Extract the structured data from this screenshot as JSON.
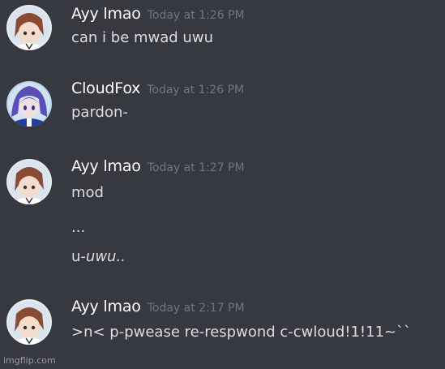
{
  "messages": [
    {
      "username": "Ayy lmao",
      "timestamp": "Today at 1:26 PM",
      "avatar_icon": "anime-avatar-brown-hair",
      "lines": [
        "can i be mwad uwu"
      ]
    },
    {
      "username": "CloudFox",
      "timestamp": "Today at 1:26 PM",
      "avatar_icon": "anime-avatar-blue-hair",
      "lines": [
        "pardon-"
      ]
    },
    {
      "username": "Ayy lmao",
      "timestamp": "Today at 1:27 PM",
      "avatar_icon": "anime-avatar-brown-hair",
      "lines": [
        "mod",
        "...",
        "u-",
        "uwu.."
      ]
    },
    {
      "username": "Ayy lmao",
      "timestamp": "Today at 2:17 PM",
      "avatar_icon": "anime-avatar-brown-hair",
      "lines": [
        ">n< p-pwease re-respwond c-cwloud!1!11~``"
      ]
    }
  ],
  "watermark": "imgflip.com",
  "colors": {
    "background": "#36393f",
    "username": "#ffffff",
    "timestamp": "#72767d",
    "message_text": "#dcddde"
  }
}
